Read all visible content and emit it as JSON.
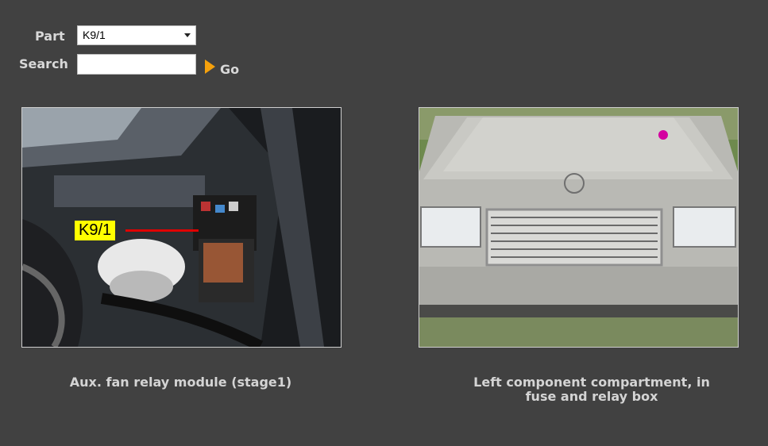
{
  "form": {
    "part_label": "Part",
    "part_value": "K9/1",
    "search_label": "Search",
    "search_value": "",
    "go_label": "Go"
  },
  "images": {
    "left": {
      "callout": "K9/1",
      "caption": "Aux. fan relay module (stage1)"
    },
    "right": {
      "caption": "Left component compartment, in fuse and relay box"
    }
  },
  "colors": {
    "background": "#414141",
    "go_arrow": "#f5a10c",
    "callout_bg": "#ffff00",
    "callout_line": "#e00000",
    "marker": "#d400a0"
  }
}
